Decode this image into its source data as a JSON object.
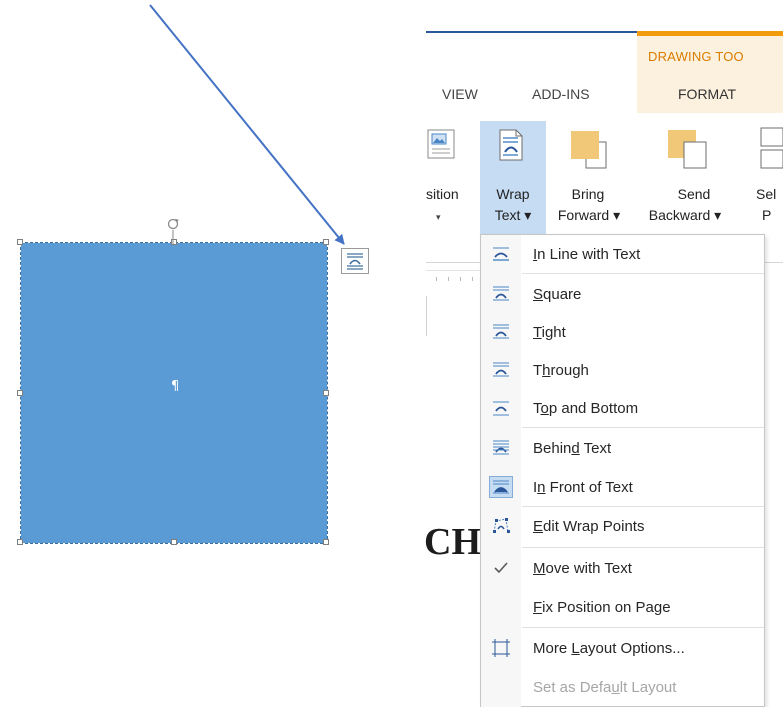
{
  "ribbon": {
    "contextual_group": "DRAWING TOO",
    "tabs": [
      "VIEW",
      "ADD-INS",
      "FORMAT"
    ],
    "buttons": {
      "position": {
        "line1": "sition",
        "line2": "▾"
      },
      "wrap_text": {
        "line1": "Wrap",
        "line2": "Text ▾"
      },
      "bring_forward": {
        "line1": "Bring",
        "line2": "Forward ▾"
      },
      "send_backward": {
        "line1": "Send",
        "line2": "Backward ▾"
      },
      "selection_pane": {
        "line1": "Sel",
        "line2": "P"
      }
    }
  },
  "document": {
    "pilcrow": "¶",
    "partial_heading": "CH"
  },
  "wrap_menu": {
    "items": [
      {
        "key": "inline",
        "pre": "",
        "u": "I",
        "post": "n Line with Text",
        "icon": "wrap-inline-icon"
      },
      {
        "key": "square",
        "pre": "",
        "u": "S",
        "post": "quare",
        "icon": "wrap-square-icon"
      },
      {
        "key": "tight",
        "pre": "",
        "u": "T",
        "post": "ight",
        "icon": "wrap-tight-icon"
      },
      {
        "key": "through",
        "pre": "T",
        "u": "h",
        "post": "rough",
        "icon": "wrap-through-icon"
      },
      {
        "key": "top-bottom",
        "pre": "T",
        "u": "o",
        "post": "p and Bottom",
        "icon": "wrap-top-bottom-icon"
      },
      {
        "key": "behind",
        "pre": "Behin",
        "u": "d",
        "post": " Text",
        "icon": "wrap-behind-icon"
      },
      {
        "key": "front",
        "pre": "I",
        "u": "n",
        "post": " Front of Text",
        "icon": "wrap-front-icon",
        "selected": true
      },
      {
        "key": "edit-points",
        "pre": "",
        "u": "E",
        "post": "dit Wrap Points",
        "icon": "edit-wrap-points-icon"
      },
      {
        "key": "move-with-text",
        "pre": "",
        "u": "M",
        "post": "ove with Text",
        "icon": "checkmark-icon",
        "checked": true
      },
      {
        "key": "fix-position",
        "pre": "",
        "u": "F",
        "post": "ix Position on Page",
        "icon": ""
      },
      {
        "key": "more-layout",
        "pre": "More ",
        "u": "L",
        "post": "ayout Options...",
        "icon": "layout-options-icon"
      },
      {
        "key": "set-default",
        "pre": "Set as Defa",
        "u": "u",
        "post": "lt Layout",
        "icon": "",
        "disabled": true
      }
    ]
  },
  "colors": {
    "shape_fill": "#5b9bd5",
    "arrow": "#4472c4",
    "contextual_tab": "#d97d00",
    "highlight": "#c5dcf3"
  }
}
